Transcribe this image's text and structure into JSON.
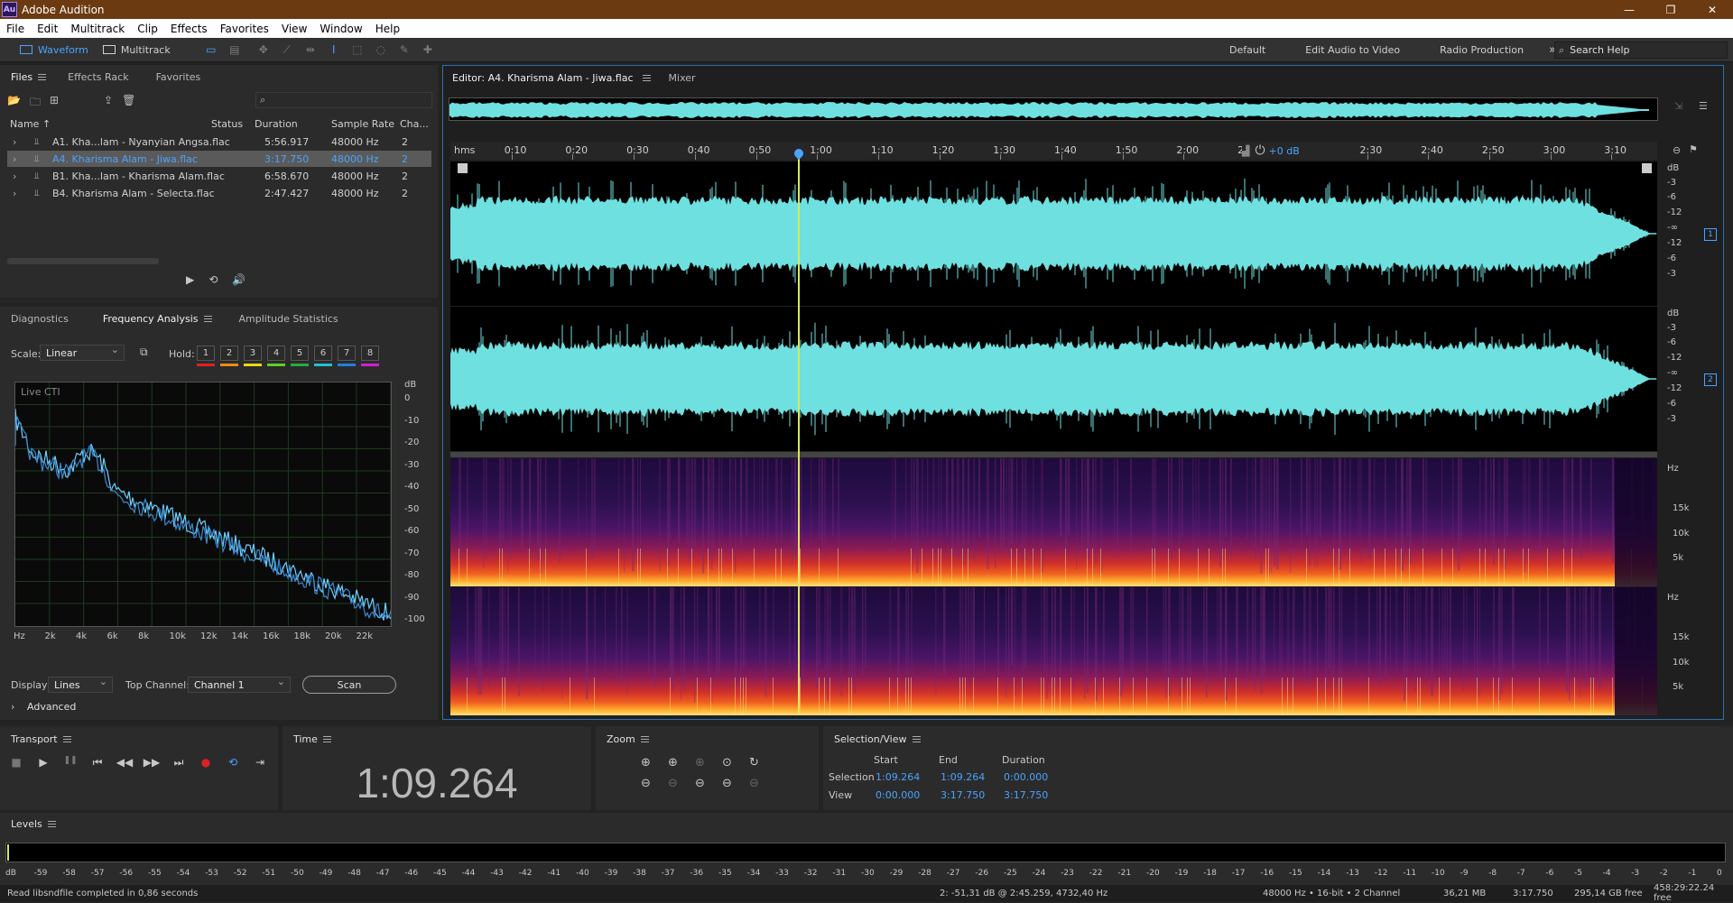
{
  "app": {
    "title": "Adobe Audition",
    "logo": "Au"
  },
  "window": {
    "minimize": "—",
    "restore": "❐",
    "close": "✕"
  },
  "menu": [
    "File",
    "Edit",
    "Multitrack",
    "Clip",
    "Effects",
    "Favorites",
    "View",
    "Window",
    "Help"
  ],
  "toolbar": {
    "waveform_label": "Waveform",
    "multitrack_label": "Multitrack",
    "workspaces": [
      "Default",
      "Edit Audio to Video",
      "Radio Production"
    ],
    "more": "»",
    "search_help": "Search Help"
  },
  "files_panel": {
    "tabs": [
      "Files",
      "Effects Rack",
      "Favorites"
    ],
    "columns": {
      "name": "Name ↑",
      "status": "Status",
      "duration": "Duration",
      "sample_rate": "Sample Rate",
      "channels": "Cha..."
    },
    "files": [
      {
        "name": "A1. Kha...lam - Nyanyian Angsa.flac",
        "duration": "5:56.917",
        "rate": "48000 Hz",
        "ch": "2",
        "selected": false
      },
      {
        "name": "A4. Kharisma Alam - Jiwa.flac",
        "duration": "3:17.750",
        "rate": "48000 Hz",
        "ch": "2",
        "selected": true
      },
      {
        "name": "B1. Kha...lam - Kharisma Alam.flac",
        "duration": "6:58.670",
        "rate": "48000 Hz",
        "ch": "2",
        "selected": false
      },
      {
        "name": "B4. Kharisma Alam - Selecta.flac",
        "duration": "2:47.427",
        "rate": "48000 Hz",
        "ch": "2",
        "selected": false
      }
    ]
  },
  "freq_panel": {
    "tabs": [
      "Diagnostics",
      "Frequency Analysis",
      "Amplitude Statistics"
    ],
    "scale_label": "Scale:",
    "scale_value": "Linear",
    "hold_label": "Hold:",
    "hold": [
      {
        "n": "1",
        "color": "#e02020"
      },
      {
        "n": "2",
        "color": "#f08a10"
      },
      {
        "n": "3",
        "color": "#e8d810"
      },
      {
        "n": "4",
        "color": "#60d020"
      },
      {
        "n": "5",
        "color": "#20b040"
      },
      {
        "n": "6",
        "color": "#20c0d0"
      },
      {
        "n": "7",
        "color": "#2080e0"
      },
      {
        "n": "8",
        "color": "#d020d0"
      }
    ],
    "live_label": "Live CTI",
    "db_unit": "dB",
    "db_ticks": [
      "0",
      "-10",
      "-20",
      "-30",
      "-40",
      "-50",
      "-60",
      "-70",
      "-80",
      "-90",
      "-100"
    ],
    "hz_ticks": [
      "Hz",
      "2k",
      "4k",
      "6k",
      "8k",
      "10k",
      "12k",
      "14k",
      "16k",
      "18k",
      "20k",
      "22k"
    ],
    "display_label": "Display:",
    "display_value": "Lines",
    "top_channel_label": "Top Channel:",
    "top_channel_value": "Channel 1",
    "scan_label": "Scan",
    "advanced_label": "Advanced"
  },
  "editor": {
    "tab": "Editor: A4. Kharisma Alam - Jiwa.flac",
    "mixer_tab": "Mixer",
    "ruler_unit": "hms",
    "ruler_ticks": [
      "0:10",
      "0:20",
      "0:30",
      "0:40",
      "0:50",
      "1:00",
      "1:10",
      "1:20",
      "1:30",
      "1:40",
      "1:50",
      "2:00",
      "2:",
      "2:30",
      "2:40",
      "2:50",
      "3:00",
      "3:10"
    ],
    "gain": "+0 dB",
    "db_scale": [
      "dB",
      "-3",
      "-6",
      "-12",
      "-∞",
      "-12",
      "-6",
      "-3"
    ],
    "hz_scale": [
      "Hz",
      "15k",
      "10k",
      "5k"
    ],
    "channel1": "1",
    "channel2": "2",
    "playhead_fraction": 0.288,
    "wave_color": "#6fe0e0"
  },
  "transport": {
    "title": "Transport",
    "icons": [
      "stop-icon",
      "play-icon",
      "pause-icon",
      "skip-back-icon",
      "rewind-icon",
      "fast-forward-icon",
      "skip-forward-icon",
      "record-icon",
      "loop-icon",
      "skip-selection-icon"
    ],
    "glyphs": [
      "■",
      "▶",
      "❚❚",
      "⏮",
      "◀◀",
      "▶▶",
      "⏭",
      "●",
      "⟲",
      "⇥"
    ]
  },
  "time": {
    "title": "Time",
    "value": "1:09.264"
  },
  "zoom": {
    "title": "Zoom"
  },
  "selection_view": {
    "title": "Selection/View",
    "headers": [
      "Start",
      "End",
      "Duration"
    ],
    "selection_label": "Selection",
    "view_label": "View",
    "selection": [
      "1:09.264",
      "1:09.264",
      "0:00.000"
    ],
    "view": [
      "0:00.000",
      "3:17.750",
      "3:17.750"
    ]
  },
  "levels": {
    "title": "Levels",
    "ticks": [
      "dB",
      "-59",
      "-58",
      "-57",
      "-56",
      "-55",
      "-54",
      "-53",
      "-52",
      "-51",
      "-50",
      "-49",
      "-48",
      "-47",
      "-46",
      "-45",
      "-44",
      "-43",
      "-42",
      "-41",
      "-40",
      "-39",
      "-38",
      "-37",
      "-36",
      "-35",
      "-34",
      "-33",
      "-32",
      "-31",
      "-30",
      "-29",
      "-28",
      "-27",
      "-26",
      "-25",
      "-24",
      "-23",
      "-22",
      "-21",
      "-20",
      "-19",
      "-18",
      "-17",
      "-16",
      "-15",
      "-14",
      "-13",
      "-12",
      "-11",
      "-10",
      "-9",
      "-8",
      "-7",
      "-6",
      "-5",
      "-4",
      "-3",
      "-2",
      "-1",
      "0"
    ]
  },
  "status": {
    "left": "Read libsndfile completed in 0,86 seconds",
    "cursor": "2: -51,31 dB @ 2:45.259, 4732,40 Hz",
    "format": "48000 Hz • 16-bit • 2 Channel",
    "size": "36,21 MB",
    "duration": "3:17.750",
    "free": "295,14 GB free",
    "free_time": "458:29:22.24 free"
  }
}
